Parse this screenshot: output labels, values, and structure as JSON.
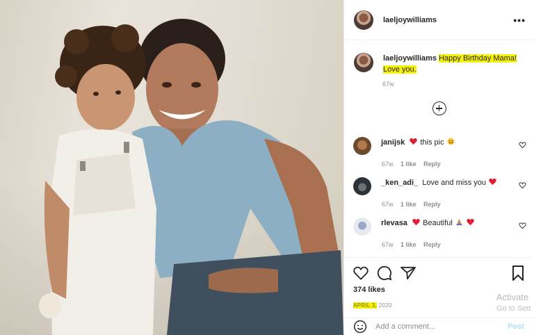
{
  "post": {
    "username": "laeljoywilliams",
    "more_icon": "more-horizontal-icon",
    "caption": {
      "username": "laeljoywilliams",
      "text": "Happy Birthday Mama! Love you.",
      "time": "67w"
    },
    "comments": [
      {
        "username": "janijsk",
        "emoji_before": "heart-red",
        "text": "this pic",
        "emoji_after": "smiling-face",
        "time": "67w",
        "likes": "1 like",
        "reply": "Reply"
      },
      {
        "username": "_ken_adi_",
        "text": "Love and miss you",
        "emoji_after": "heart-red",
        "time": "67w",
        "likes": "1 like",
        "reply": "Reply"
      },
      {
        "username": "rlevasa",
        "emoji_before": "heart-red",
        "text": "Beautiful",
        "emoji_after": "praying-hands heart-red",
        "time": "67w",
        "likes": "1 like",
        "reply": "Reply"
      }
    ],
    "likes": "374 likes",
    "date": "APRIL 3,",
    "year": "2020",
    "add_comment_placeholder": "Add a comment...",
    "post_label": "Post",
    "accent": "#0095f6",
    "highlight": "#f6f10a"
  },
  "watermark": {
    "line1": "Activate",
    "line2": "Go to Sett"
  }
}
